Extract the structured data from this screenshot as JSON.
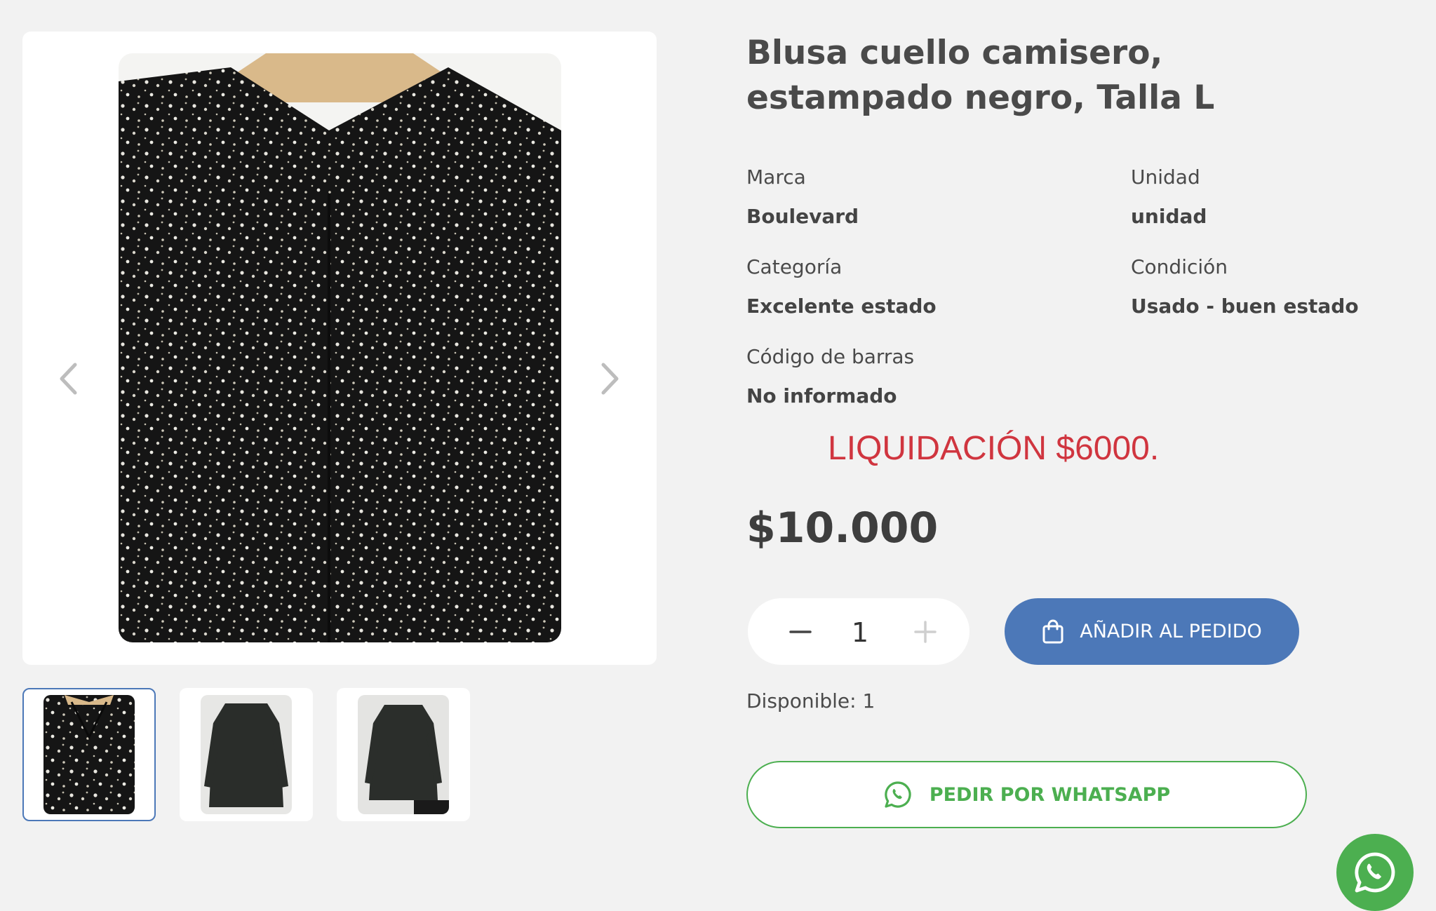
{
  "product": {
    "title": "Blusa cuello camisero, estampado negro, Talla L",
    "specs": [
      {
        "label": "Marca",
        "value": "Boulevard"
      },
      {
        "label": "Unidad",
        "value": "unidad"
      },
      {
        "label": "Categoría",
        "value": "Excelente estado"
      },
      {
        "label": "Condición",
        "value": "Usado - buen estado"
      },
      {
        "label": "Código de barras",
        "value": "No informado"
      }
    ],
    "promo": "LIQUIDACIÓN $6000.",
    "price": "$10.000"
  },
  "gallery": {
    "main_image": "black-floral-blouse-photo",
    "thumbnails": [
      {
        "name": "blouse-closeup",
        "active": true
      },
      {
        "name": "blouse-front",
        "active": false
      },
      {
        "name": "blouse-front-2",
        "active": false
      }
    ]
  },
  "cart": {
    "quantity": "1",
    "add_label": "AÑADIR AL PEDIDO",
    "stock_text": "Disponible: 1"
  },
  "whatsapp": {
    "button_label": "PEDIR POR WHATSAPP"
  },
  "colors": {
    "accent": "#4c78b8",
    "promo": "#d0353f",
    "whatsapp": "#4caf50"
  }
}
